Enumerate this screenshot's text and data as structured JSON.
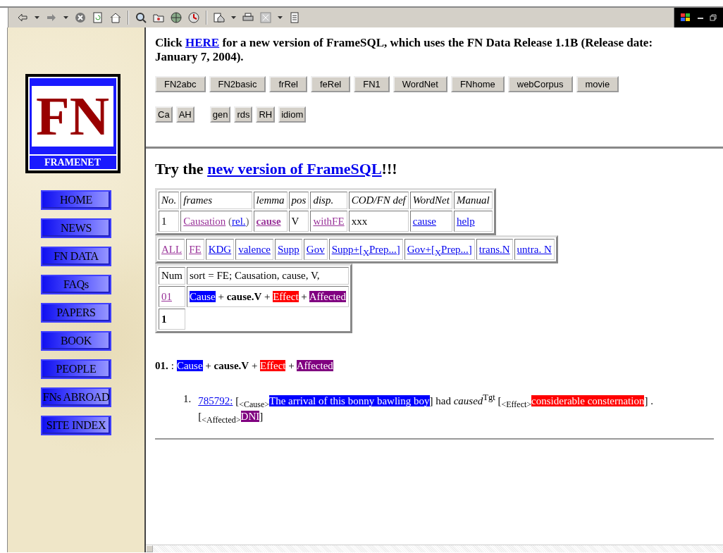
{
  "sidebar": {
    "logo": {
      "mark": "FN",
      "caption": "FRAMENET"
    },
    "nav": [
      "HOME",
      "NEWS",
      "FN DATA",
      "FAQs",
      "PAPERS",
      "BOOK",
      "PEOPLE",
      "FNs ABROAD",
      "SITE INDEX"
    ]
  },
  "top_frame": {
    "notice": {
      "before": "Click",
      "link": "HERE",
      "after": "for a new version of FrameSQL, which uses the FN Data Release 1.1B (Release date: January 7, 2004)."
    },
    "button_rows": [
      [
        [
          "FN2abc",
          "FN2basic",
          "frRel",
          "feRel",
          "FN1",
          "WordNet",
          "FNhome",
          "webCorpus",
          "movie"
        ]
      ],
      [
        [
          "Ca",
          "AH"
        ],
        [
          "gen",
          "rds",
          "RH",
          "idiom"
        ]
      ]
    ]
  },
  "main": {
    "heading": {
      "before": "Try the",
      "link": "new version of FrameSQL",
      "after": "!!!"
    },
    "frame_table": {
      "columns": [
        "No.",
        "frames",
        "lemma",
        "pos",
        "disp.",
        "COD/FN def",
        "WordNet",
        "Manual"
      ],
      "rows": [
        {
          "no": "1",
          "frame": {
            "text": "Causation",
            "visited": true
          },
          "rel": {
            "open": "(",
            "text": "rel.",
            "close": ")",
            "visited": false
          },
          "lemma": {
            "text": "cause",
            "visited": true
          },
          "pos": "V",
          "disp": {
            "text": "withFE",
            "visited": true
          },
          "def": "xxx",
          "wordnet": {
            "text": "cause",
            "visited": false
          },
          "manual": {
            "text": "help",
            "visited": false
          }
        }
      ]
    },
    "view_links": [
      {
        "text": "ALL",
        "visited": true
      },
      {
        "text": "FE",
        "visited": true
      },
      {
        "text": "KDG",
        "visited": false
      },
      {
        "text": "valence",
        "visited": false
      },
      {
        "text": "Supp",
        "visited": false
      },
      {
        "text": "Gov",
        "visited": false
      },
      {
        "text": "Supp+[$_{X}$Prep...]",
        "visited": false
      },
      {
        "text": "Gov+[$_{X}$Prep...]",
        "visited": false
      },
      {
        "text": "trans.N",
        "visited": false
      },
      {
        "text": "untra. N",
        "visited": false
      }
    ],
    "pattern_table": {
      "columns": [
        "Num",
        "sort = FE; Causation, cause, V,"
      ],
      "rows": [
        {
          "num": {
            "text": "01",
            "visited": true
          },
          "pattern": [
            {
              "kind": "fe",
              "text": "Cause",
              "color": "#0000ff"
            },
            {
              "kind": "plain",
              "text": "+"
            },
            {
              "kind": "target",
              "text": "cause.V"
            },
            {
              "kind": "plain",
              "text": "+"
            },
            {
              "kind": "fe",
              "text": "Effect",
              "color": "#ff0000"
            },
            {
              "kind": "plain",
              "text": "+"
            },
            {
              "kind": "fe",
              "text": "Affected",
              "color": "#800080"
            }
          ]
        }
      ],
      "total": "1"
    },
    "results": [
      {
        "label": "01.",
        "sep": ":",
        "pattern": [
          {
            "kind": "fe",
            "text": "Cause",
            "color": "#0000ff"
          },
          {
            "kind": "plain",
            "text": "+"
          },
          {
            "kind": "target",
            "text": "cause.V"
          },
          {
            "kind": "plain",
            "text": "+"
          },
          {
            "kind": "fe",
            "text": "Effect",
            "color": "#ff0000"
          },
          {
            "kind": "plain",
            "text": "+"
          },
          {
            "kind": "fe",
            "text": "Affected",
            "color": "#800080"
          }
        ],
        "sentences": [
          {
            "number": "1.",
            "id": "785792:",
            "parts": [
              {
                "kind": "fe",
                "open": "[",
                "label": "<Cause>",
                "text": "The arrival of this bonny bawling boy",
                "color": "#0000ff",
                "close": "]"
              },
              {
                "kind": "plain",
                "text": "had"
              },
              {
                "kind": "target",
                "text": "caused",
                "tag": "Tgt"
              },
              {
                "kind": "fe",
                "open": "[",
                "label": "<Effect>",
                "text": "considerable consternation",
                "color": "#ff0000",
                "close": "]"
              },
              {
                "kind": "plain",
                "text": "."
              },
              {
                "kind": "fe",
                "open": "[",
                "label": "<Affected>",
                "text": "DNI",
                "color": "#800080",
                "close": "]"
              }
            ]
          }
        ]
      }
    ]
  }
}
